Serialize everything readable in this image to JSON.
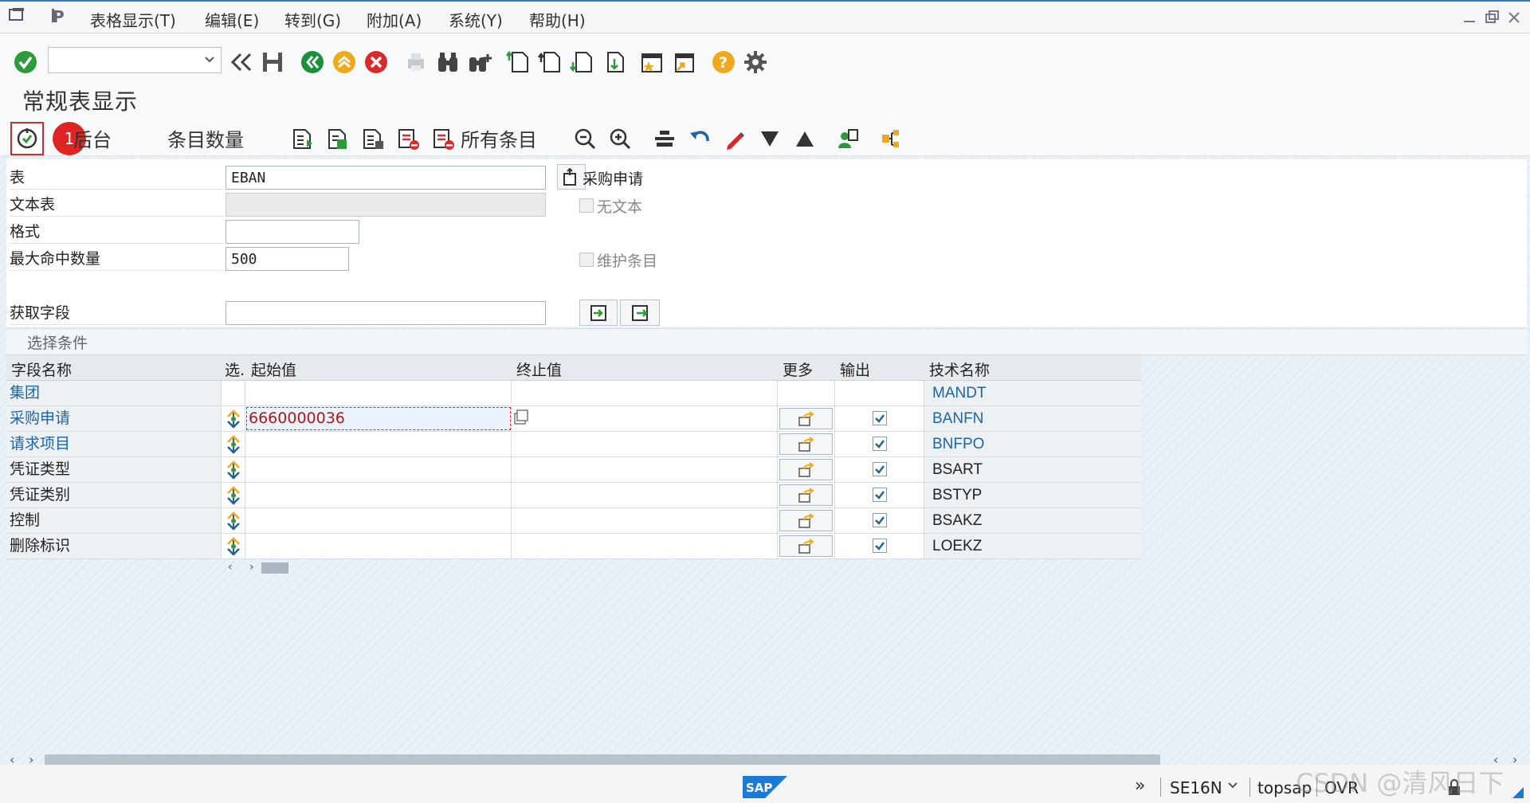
{
  "menu": {
    "items": [
      "表格显示(T)",
      "编辑(E)",
      "转到(G)",
      "附加(A)",
      "系统(Y)",
      "帮助(H)"
    ]
  },
  "toolbar": {
    "command_field_value": "",
    "icons": [
      "enter-icon",
      "back-icon",
      "save-icon",
      "back-green-icon",
      "exit-icon",
      "cancel-icon",
      "print-icon",
      "find-icon",
      "find-next-icon",
      "first-page-icon",
      "prev-page-icon",
      "next-page-icon",
      "last-page-icon",
      "new-session-icon",
      "shortcut-icon",
      "help-icon",
      "settings-icon"
    ]
  },
  "page": {
    "title": "常规表显示"
  },
  "app_toolbar": {
    "execute_badge": "1",
    "background_label": "后台",
    "entries_count_label": "条目数量",
    "all_entries_label": "所有条目"
  },
  "form": {
    "table_label": "表",
    "table_value": "EBAN",
    "table_desc": "采购申请",
    "text_table_label": "文本表",
    "text_table_value": "",
    "no_text_label": "无文本",
    "layout_label": "格式",
    "layout_value": "",
    "max_hits_label": "最大命中数量",
    "max_hits_value": "500",
    "maintain_entries_label": "维护条目",
    "get_fields_label": "获取字段",
    "get_fields_value": ""
  },
  "selection": {
    "section_title": "选择条件",
    "columns": {
      "field_name": "字段名称",
      "option": "选.",
      "from": "起始值",
      "to": "终止值",
      "more": "更多",
      "output": "输出",
      "tech_name": "技术名称"
    },
    "rows": [
      {
        "field": "集团",
        "from": "",
        "to": "",
        "output": false,
        "tech": "MANDT",
        "link": true,
        "has_controls": false
      },
      {
        "field": "采购申请",
        "from": "6660000036",
        "to": "",
        "output": true,
        "tech": "BANFN",
        "link": true,
        "has_controls": true
      },
      {
        "field": "请求项目",
        "from": "",
        "to": "",
        "output": true,
        "tech": "BNFPO",
        "link": true,
        "has_controls": true
      },
      {
        "field": "凭证类型",
        "from": "",
        "to": "",
        "output": true,
        "tech": "BSART",
        "link": false,
        "has_controls": true
      },
      {
        "field": "凭证类别",
        "from": "",
        "to": "",
        "output": true,
        "tech": "BSTYP",
        "link": false,
        "has_controls": true
      },
      {
        "field": "控制",
        "from": "",
        "to": "",
        "output": true,
        "tech": "BSAKZ",
        "link": false,
        "has_controls": true
      },
      {
        "field": "删除标识",
        "from": "",
        "to": "",
        "output": true,
        "tech": "LOEKZ",
        "link": false,
        "has_controls": true
      }
    ]
  },
  "status": {
    "transaction": "SE16N",
    "system": "topsap",
    "mode": "OVR",
    "watermark": "CSDN @清风日下"
  },
  "colors": {
    "link": "#1c64a8",
    "accent_blue": "#3c7ab8",
    "danger_red": "#d92b2b",
    "success_green": "#2f9a3c",
    "warning_orange": "#f0a81c"
  }
}
